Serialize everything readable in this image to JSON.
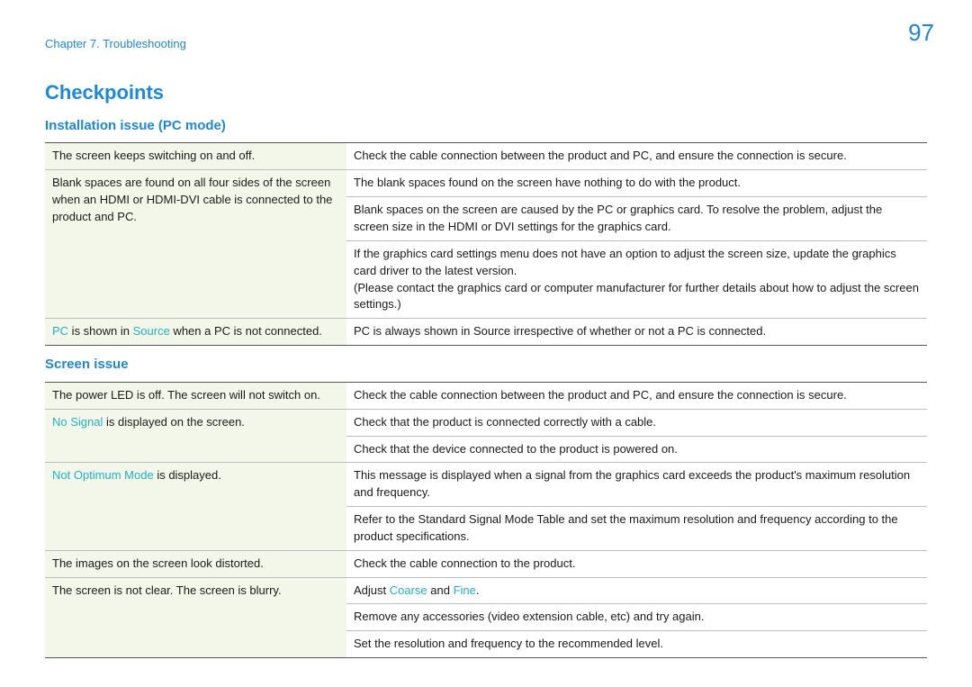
{
  "header": {
    "chapter": "Chapter 7. Troubleshooting",
    "page_number": "97"
  },
  "title": "Checkpoints",
  "sections": [
    {
      "heading": "Installation issue (PC mode)",
      "rows": [
        {
          "symptom_parts": [
            {
              "text": "The screen keeps switching on and off.",
              "class": ""
            }
          ],
          "solutions": [
            "Check the cable connection between the product and PC, and ensure the connection is secure."
          ],
          "symptom_rowspan": 1
        },
        {
          "symptom_parts": [
            {
              "text": "Blank spaces are found on all four sides of the screen when an HDMI or HDMI-DVI cable is connected to the product and PC.",
              "class": ""
            }
          ],
          "solutions": [
            "The blank spaces found on the screen have nothing to do with the product.",
            "Blank spaces on the screen are caused by the PC or graphics card. To resolve the problem, adjust the screen size in the HDMI or DVI settings for the graphics card.",
            "If the graphics card settings menu does not have an option to adjust the screen size, update the graphics card driver to the latest version.",
            "(Please contact the graphics card or computer manufacturer for further details about how to adjust the screen settings.)"
          ],
          "symptom_rowspan": 4,
          "merge_last_two": true
        },
        {
          "symptom_parts": [
            {
              "text": "PC",
              "class": "aqua"
            },
            {
              "text": " is shown in ",
              "class": ""
            },
            {
              "text": "Source",
              "class": "aqua"
            },
            {
              "text": " when a PC is not connected.",
              "class": ""
            }
          ],
          "solutions": [
            "PC is always shown in Source irrespective of whether or not a PC is connected."
          ],
          "symptom_rowspan": 1
        }
      ]
    },
    {
      "heading": "Screen issue",
      "rows": [
        {
          "symptom_parts": [
            {
              "text": "The power LED is off. The screen will not switch on.",
              "class": ""
            }
          ],
          "solutions": [
            "Check the cable connection between the product and PC, and ensure the connection is secure."
          ],
          "symptom_rowspan": 1
        },
        {
          "symptom_parts": [
            {
              "text": "No Signal",
              "class": "aqua"
            },
            {
              "text": " is displayed on the screen.",
              "class": ""
            }
          ],
          "solutions": [
            "Check that the product is connected correctly with a cable.",
            "Check that the device connected to the product is powered on."
          ],
          "symptom_rowspan": 2
        },
        {
          "symptom_parts": [
            {
              "text": "Not Optimum Mode",
              "class": "aqua"
            },
            {
              "text": " is displayed.",
              "class": ""
            }
          ],
          "solutions": [
            "This message is displayed when a signal from the graphics card exceeds the product's maximum resolution and frequency.",
            "Refer to the Standard Signal Mode Table and set the maximum resolution and frequency according to the product specifications."
          ],
          "symptom_rowspan": 2
        },
        {
          "symptom_parts": [
            {
              "text": "The images on the screen look distorted.",
              "class": ""
            }
          ],
          "solutions": [
            "Check the cable connection to the product."
          ],
          "symptom_rowspan": 1
        },
        {
          "symptom_parts": [
            {
              "text": "The screen is not clear. The screen is blurry.",
              "class": ""
            }
          ],
          "solutions_rich": [
            [
              {
                "text": "Adjust ",
                "class": ""
              },
              {
                "text": "Coarse",
                "class": "aqua"
              },
              {
                "text": " and ",
                "class": ""
              },
              {
                "text": "Fine",
                "class": "aqua"
              },
              {
                "text": ".",
                "class": ""
              }
            ]
          ],
          "solutions": [
            "Remove any accessories (video extension cable, etc) and try again.",
            "Set the resolution and frequency to the recommended level."
          ],
          "symptom_rowspan": 3
        }
      ]
    }
  ]
}
